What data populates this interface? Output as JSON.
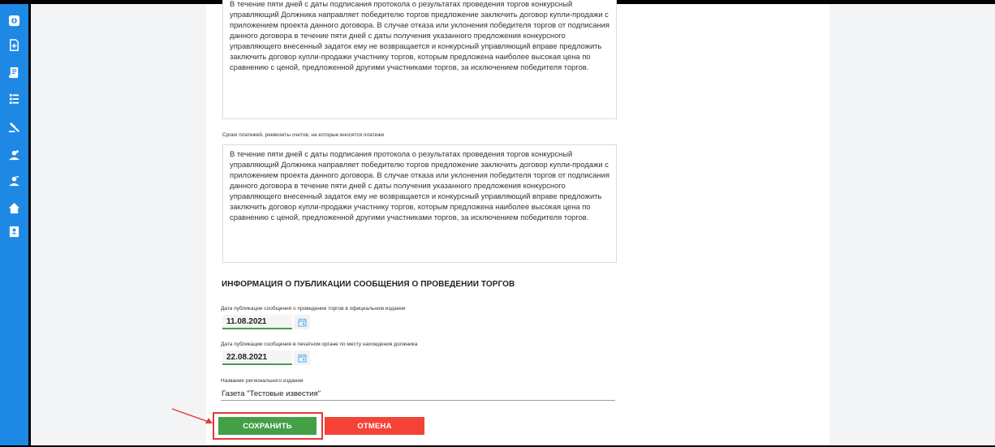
{
  "sidebar": {
    "icons": [
      "dashboard-icon",
      "document-plus-icon",
      "scroll-icon",
      "list-icon",
      "gavel-icon",
      "person-plus-icon",
      "person-minus-icon",
      "home-icon",
      "contacts-book-icon"
    ],
    "color": "#1e88e5"
  },
  "form": {
    "text_above": "В течение пяти дней с даты подписания протокола о результатах проведения торгов конкурсный управляющий Должника направляет победителю торгов предложение заключить договор купли-продажи с приложением проекта данного договора. В случае отказа или уклонения победителя торгов от подписания данного договора в течение пяти дней с даты получения указанного предложения конкурсного управляющего внесенный задаток ему не возвращается и конкурсный управляющий вправе предложить заключить договор купли-продажи участнику торгов, которым предложена наиболее высокая цена по сравнению с ценой, предложенной другими участниками торгов, за исключением победителя торгов.",
    "payment_terms_label": "Сроки платежей, реквизиты счетов, на которые вносятся платежи",
    "payment_terms_value": "В течение пяти дней с даты подписания протокола о результатах проведения торгов конкурсный управляющий Должника направляет победителю торгов предложение заключить договор купли-продажи с приложением проекта данного договора. В случае отказа или уклонения победителя торгов от подписания данного договора в течение пяти дней с даты получения указанного предложения конкурсного управляющего внесенный задаток ему не возвращается и конкурсный управляющий вправе предложить заключить договор купли-продажи участнику торгов, которым предложена наиболее высокая цена по сравнению с ценой, предложенной другими участниками торгов, за исключением победителя торгов."
  },
  "publication": {
    "section_title": "ИНФОРМАЦИЯ О ПУБЛИКАЦИИ СООБЩЕНИЯ О ПРОВЕДЕНИИ ТОРГОВ",
    "official_date_label": "Дата публикации сообщения о проведении торгов в официальном издании",
    "official_date_value": "11.08.2021",
    "print_date_label": "Дата публикации сообщения в печатном органе по месту нахождения должника",
    "print_date_value": "22.08.2021",
    "regional_label": "Название регионального издания",
    "regional_value": "Газета \"Тестовые известия\""
  },
  "actions": {
    "save_label": "СОХРАНИТЬ",
    "cancel_label": "ОТМЕНА",
    "save_color": "#43a047",
    "cancel_color": "#f44336",
    "highlight_color": "#e53935"
  }
}
